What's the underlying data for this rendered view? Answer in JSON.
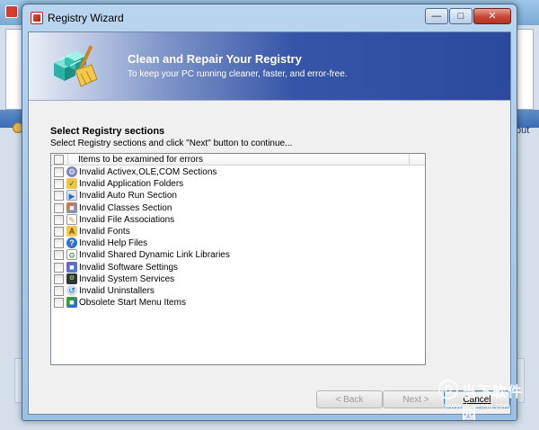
{
  "background": {
    "side_text": "put"
  },
  "window": {
    "title": "Registry Wizard",
    "buttons": [
      "minimize",
      "maximize",
      "close"
    ]
  },
  "banner": {
    "title": "Clean and Repair Your Registry",
    "subtitle": "To keep your PC running cleaner, faster, and error-free."
  },
  "section": {
    "title": "Select Registry sections",
    "description": "Select Registry sections and click \"Next\" button to continue..."
  },
  "list": {
    "header": "Items to be examined for errors",
    "items": [
      {
        "label": "Invalid Activex,OLE,COM Sections",
        "icon": "gear-icon",
        "checked": false
      },
      {
        "label": "Invalid Application Folders",
        "icon": "folder-check-icon",
        "checked": false
      },
      {
        "label": "Invalid Auto Run Section",
        "icon": "autorun-icon",
        "checked": false
      },
      {
        "label": "Invalid Classes Section",
        "icon": "classes-icon",
        "checked": false
      },
      {
        "label": "Invalid File Associations",
        "icon": "file-association-icon",
        "checked": false
      },
      {
        "label": "Invalid Fonts",
        "icon": "fonts-folder-icon",
        "checked": false
      },
      {
        "label": "Invalid Help Files",
        "icon": "help-icon",
        "checked": false
      },
      {
        "label": "Invalid Shared Dynamic Link Libraries",
        "icon": "dll-icon",
        "checked": false
      },
      {
        "label": "Invalid Software Settings",
        "icon": "software-settings-icon",
        "checked": false
      },
      {
        "label": "Invalid System Services",
        "icon": "services-icon",
        "checked": false
      },
      {
        "label": "Invalid Uninstallers",
        "icon": "uninstaller-icon",
        "checked": false
      },
      {
        "label": "Obsolete Start Menu Items",
        "icon": "start-menu-icon",
        "checked": false
      }
    ]
  },
  "footer": {
    "back": "< Back",
    "next": "Next >",
    "cancel": "Cancel"
  },
  "watermark": {
    "logo_glyph": "D",
    "name": "当下软件园",
    "url": "www.downxia.com"
  },
  "colors": {
    "banner_dark": "#2b4a9e",
    "banner_light": "#e9eef7",
    "close_button": "#c74634",
    "window_frame": "#9cc0e4"
  }
}
